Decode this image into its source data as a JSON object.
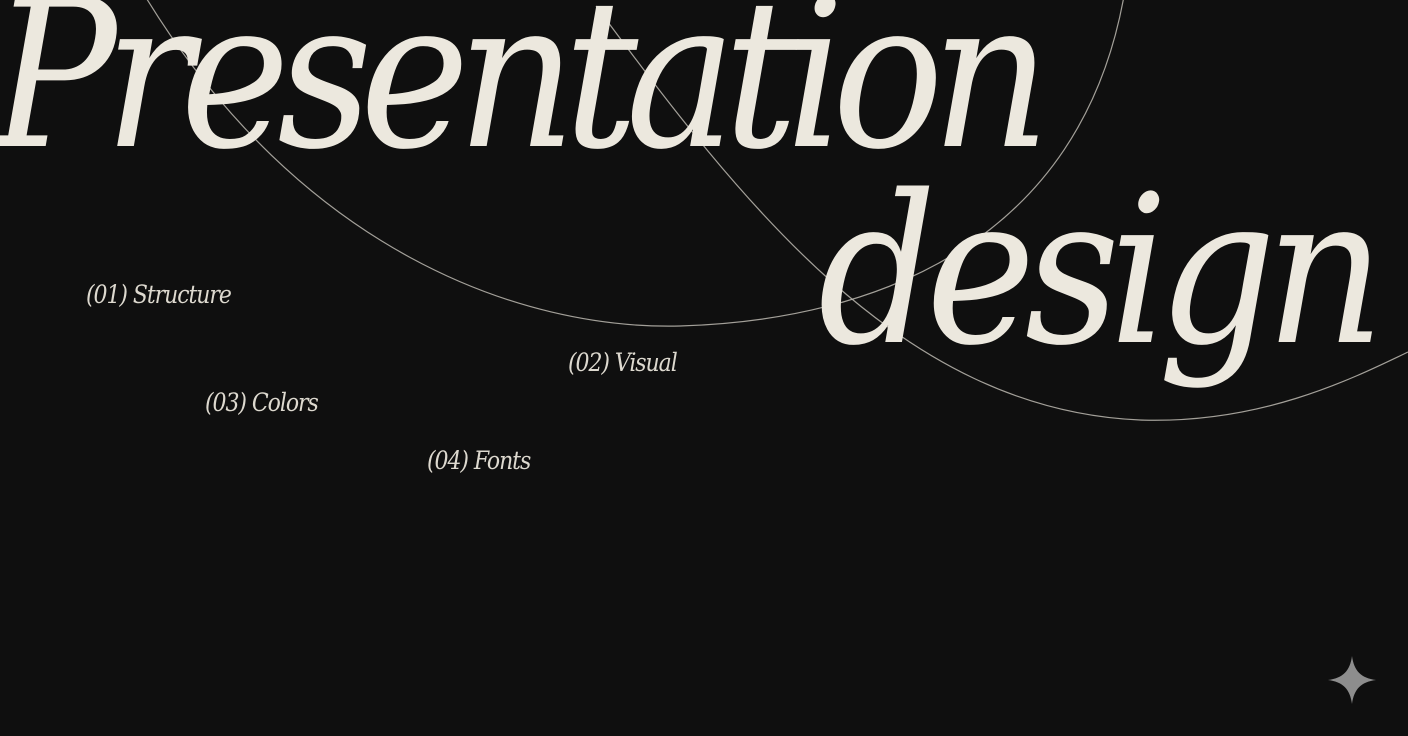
{
  "title": {
    "line1": "Presentation",
    "line2": "design"
  },
  "toc": [
    {
      "label": "(01) Structure"
    },
    {
      "label": "(02) Visual"
    },
    {
      "label": "(03) Colors"
    },
    {
      "label": "(04) Fonts"
    }
  ],
  "colors": {
    "background": "#0f0f0f",
    "title_text": "#ece8de",
    "toc_text": "#ddd9cf",
    "arc_stroke": "#bdbab2",
    "sparkle": "#8d8d8d"
  },
  "icons": {
    "corner": "sparkle-icon"
  }
}
